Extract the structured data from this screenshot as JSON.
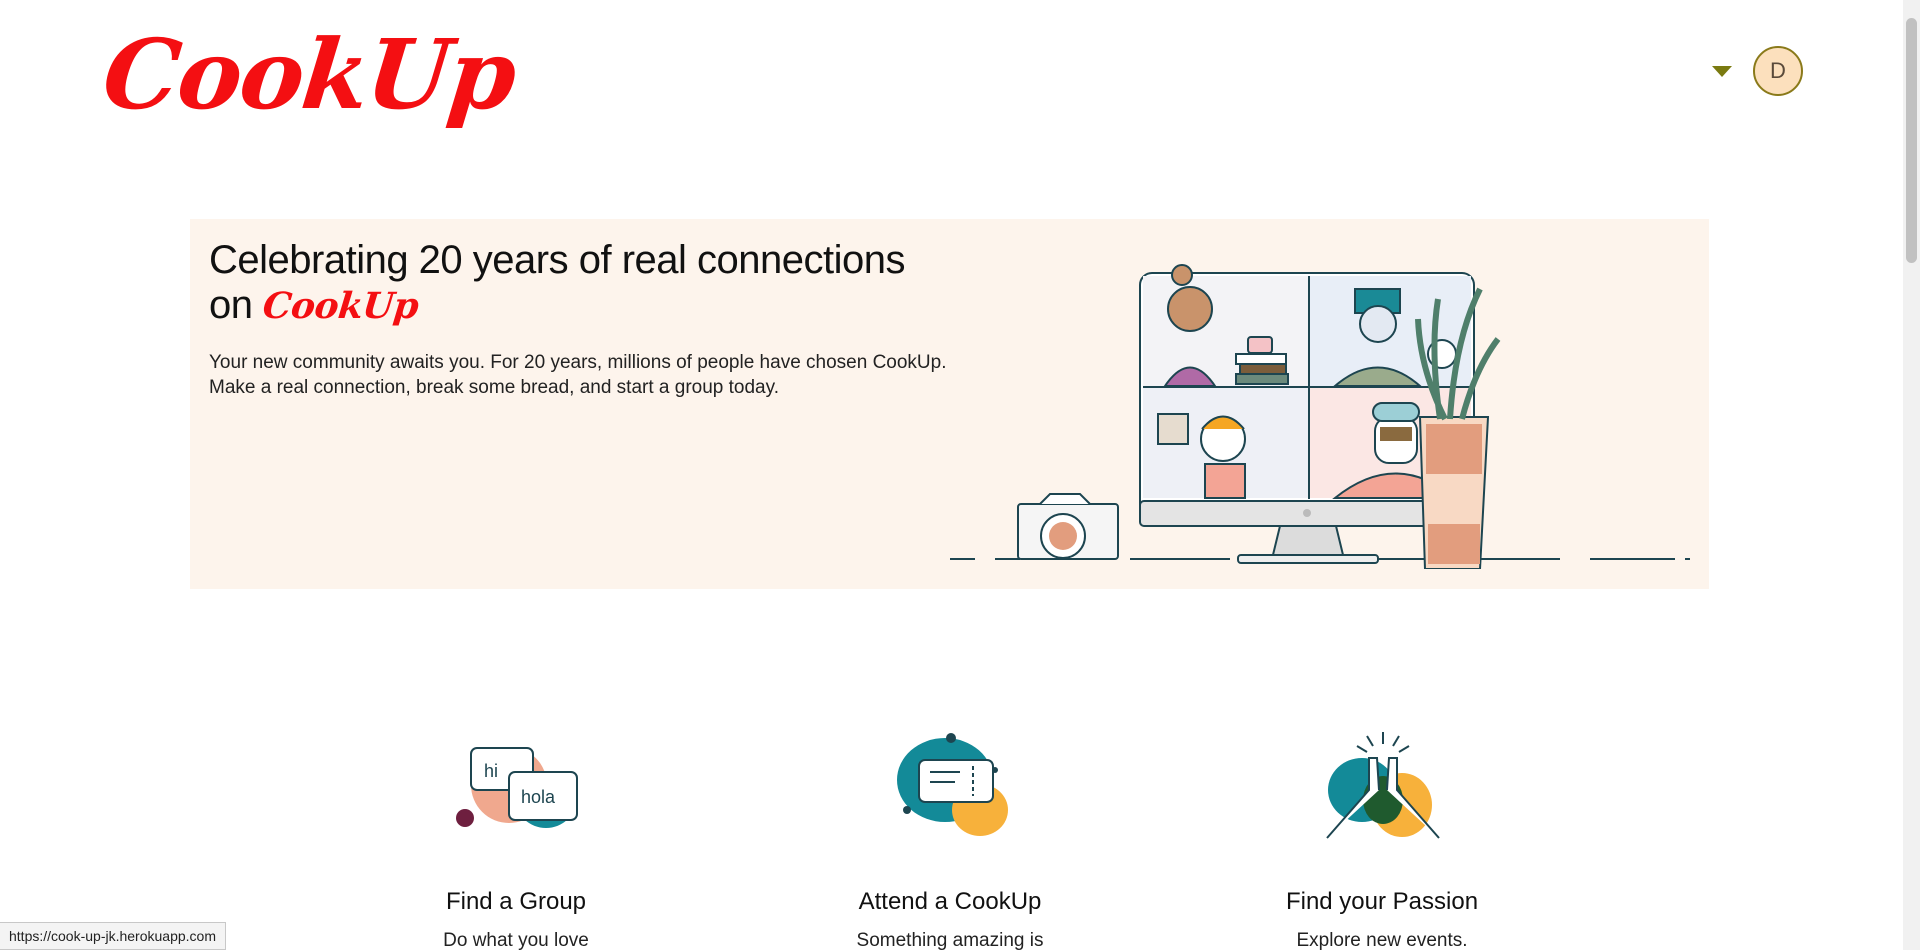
{
  "header": {
    "logo_text": "CookUp",
    "avatar_initial": "D",
    "brand_color": "#f40f12"
  },
  "hero": {
    "title_line": "Celebrating 20 years of real connections",
    "title_on": "on",
    "title_brand": "CookUp",
    "description": "Your new community awaits you. For 20 years, millions of people have chosen CookUp. Make a real connection, break some bread, and start a group today.",
    "background": "#fdf4ec"
  },
  "features": [
    {
      "title": "Find a Group",
      "desc": "Do what you love",
      "icon": "chat-bubbles-icon"
    },
    {
      "title": "Attend a CookUp",
      "desc": "Something amazing is",
      "icon": "ticket-icon"
    },
    {
      "title": "Find your Passion",
      "desc": "Explore new events.",
      "icon": "high-five-icon"
    }
  ],
  "status_bar": {
    "url": "https://cook-up-jk.herokuapp.com"
  }
}
